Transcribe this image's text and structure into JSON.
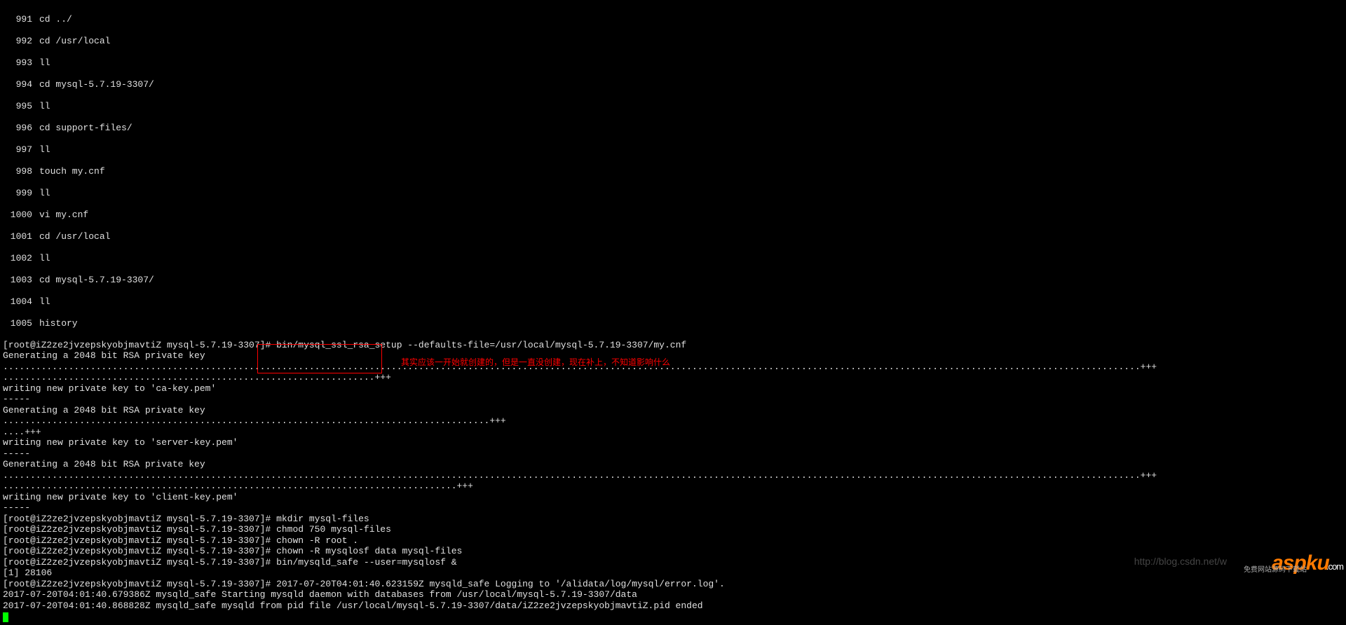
{
  "history": [
    {
      "num": "991",
      "cmd": "cd ../"
    },
    {
      "num": "992",
      "cmd": "cd /usr/local"
    },
    {
      "num": "993",
      "cmd": "ll"
    },
    {
      "num": "994",
      "cmd": "cd mysql-5.7.19-3307/"
    },
    {
      "num": "995",
      "cmd": "ll"
    },
    {
      "num": "996",
      "cmd": "cd support-files/"
    },
    {
      "num": "997",
      "cmd": "ll"
    },
    {
      "num": "998",
      "cmd": "touch my.cnf"
    },
    {
      "num": "999",
      "cmd": "ll"
    },
    {
      "num": "1000",
      "cmd": "vi my.cnf"
    },
    {
      "num": "1001",
      "cmd": "cd /usr/local"
    },
    {
      "num": "1002",
      "cmd": "ll"
    },
    {
      "num": "1003",
      "cmd": "cd mysql-5.7.19-3307/"
    },
    {
      "num": "1004",
      "cmd": "ll"
    },
    {
      "num": "1005",
      "cmd": "history"
    }
  ],
  "prompt": "[root@iZ2ze2jvzepskyobjmavtiZ mysql-5.7.19-3307]# ",
  "lines": {
    "l1": "bin/mysql_ssl_rsa_setup --defaults-file=/usr/local/mysql-5.7.19-3307/my.cnf",
    "l2": "Generating a 2048 bit RSA private key",
    "dots1": "................................................................................................................................................................................................................+++",
    "dots2": "....................................................................+++",
    "l3": "writing new private key to 'ca-key.pem'",
    "dash": "-----",
    "l4": "Generating a 2048 bit RSA private key",
    "dots3": ".........................................................................................+++",
    "dots4": "....+++",
    "l5": "writing new private key to 'server-key.pem'",
    "l6": "Generating a 2048 bit RSA private key",
    "dots5": "................................................................................................................................................................................................................+++",
    "dots6": "...................................................................................+++",
    "l7": "writing new private key to 'client-key.pem'",
    "cmd_mkdir": "mkdir mysql-files",
    "cmd_chmod": "chmod 750 mysql-files",
    "cmd_chown1": "chown -R root .",
    "cmd_chown2": "chown -R mysqlosf data mysql-files",
    "cmd_safe": "bin/mysqld_safe --user=mysqlosf &",
    "job": "[1] 28106",
    "log1": "2017-07-20T04:01:40.623159Z mysqld_safe Logging to '/alidata/log/mysql/error.log'.",
    "log2": "2017-07-20T04:01:40.679386Z mysqld_safe Starting mysqld daemon with databases from /usr/local/mysql-5.7.19-3307/data",
    "log3": "2017-07-20T04:01:40.868828Z mysqld_safe mysqld from pid file /usr/local/mysql-5.7.19-3307/data/iZ2ze2jvzepskyobjmavtiZ.pid ended"
  },
  "annotation": {
    "note": "其实应该一开始就创建的，但是一直没创建，现在补上，不知道影响什么"
  },
  "watermark": {
    "url": "http://blog.csdn.net/w",
    "brand": "aspku",
    "brand_suffix": ".com",
    "sub": "免费网站源码下载站"
  }
}
